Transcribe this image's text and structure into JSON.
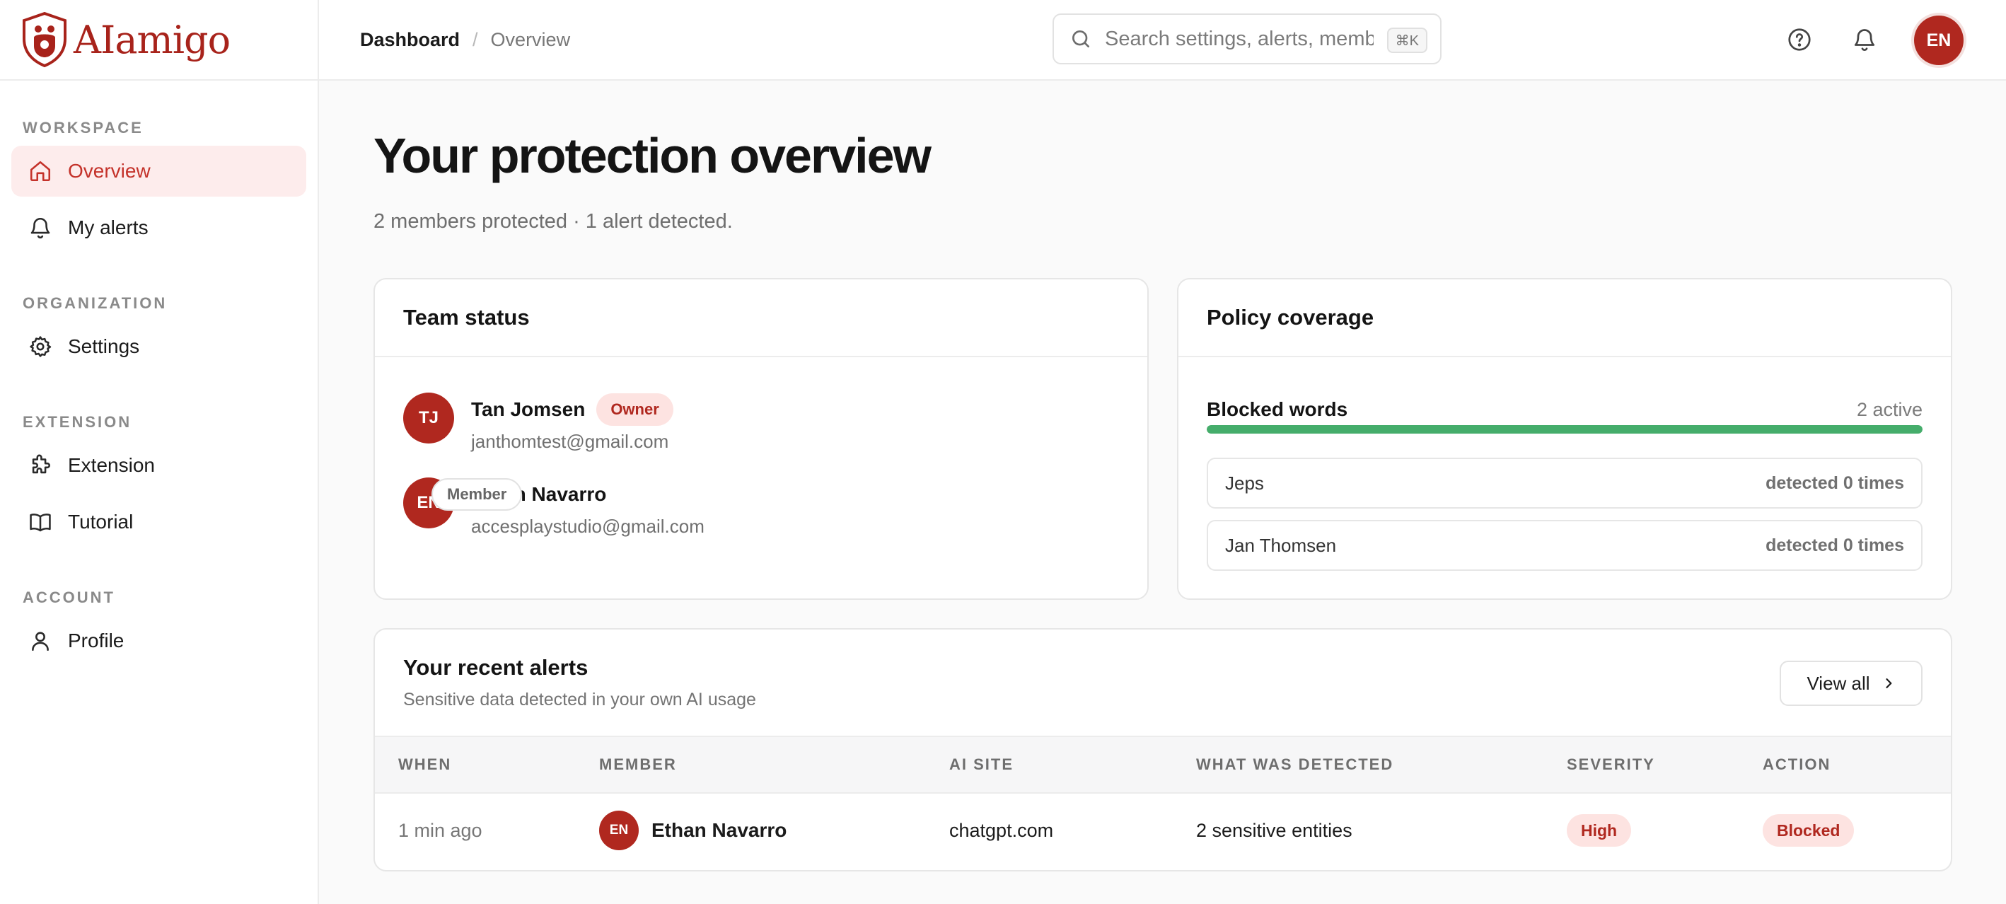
{
  "brand": {
    "name": "AIamigo"
  },
  "sidebar": {
    "sections": [
      {
        "label": "WORKSPACE",
        "items": [
          {
            "label": "Overview",
            "icon": "home-icon",
            "active": true
          },
          {
            "label": "My alerts",
            "icon": "bell-icon"
          }
        ]
      },
      {
        "label": "ORGANIZATION",
        "items": [
          {
            "label": "Settings",
            "icon": "gear-icon"
          }
        ]
      },
      {
        "label": "EXTENSION",
        "items": [
          {
            "label": "Extension",
            "icon": "puzzle-icon"
          },
          {
            "label": "Tutorial",
            "icon": "book-icon"
          }
        ]
      },
      {
        "label": "ACCOUNT",
        "items": [
          {
            "label": "Profile",
            "icon": "user-icon"
          }
        ]
      }
    ]
  },
  "header": {
    "breadcrumb": {
      "root": "Dashboard",
      "separator": "/",
      "current": "Overview"
    },
    "search": {
      "placeholder": "Search settings, alerts, members",
      "shortcut": "⌘K"
    },
    "user_initials": "EN"
  },
  "page": {
    "title": "Your protection overview",
    "subtitle": "2 members protected · 1 alert detected."
  },
  "team_status": {
    "title": "Team status",
    "members": [
      {
        "initials": "TJ",
        "name": "Tan Jomsen",
        "role": "Owner",
        "email": "janthomtest@gmail.com"
      },
      {
        "initials": "EN",
        "name": "Ethan Navarro",
        "role": "Member",
        "email": "accesplaystudio@gmail.com"
      }
    ]
  },
  "policy": {
    "title": "Policy coverage",
    "label": "Blocked words",
    "count": "2 active",
    "progress": 1.0,
    "words": [
      {
        "word": "Jeps",
        "detections": "detected 0 times"
      },
      {
        "word": "Jan Thomsen",
        "detections": "detected 0 times"
      }
    ]
  },
  "alerts": {
    "title": "Your recent alerts",
    "subtitle": "Sensitive data detected in your own AI usage",
    "view_all": "View all",
    "columns": [
      "WHEN",
      "MEMBER",
      "AI SITE",
      "WHAT WAS DETECTED",
      "SEVERITY",
      "ACTION"
    ],
    "rows": [
      {
        "when": "1 min ago",
        "member_initials": "EN",
        "member": "Ethan Navarro",
        "site": "chatgpt.com",
        "detected": "2 sensitive entities",
        "severity": "High",
        "action": "Blocked"
      }
    ]
  },
  "colors": {
    "accent": "#b0281f",
    "active_bg": "#fdecec",
    "progress": "#45ad6b"
  }
}
